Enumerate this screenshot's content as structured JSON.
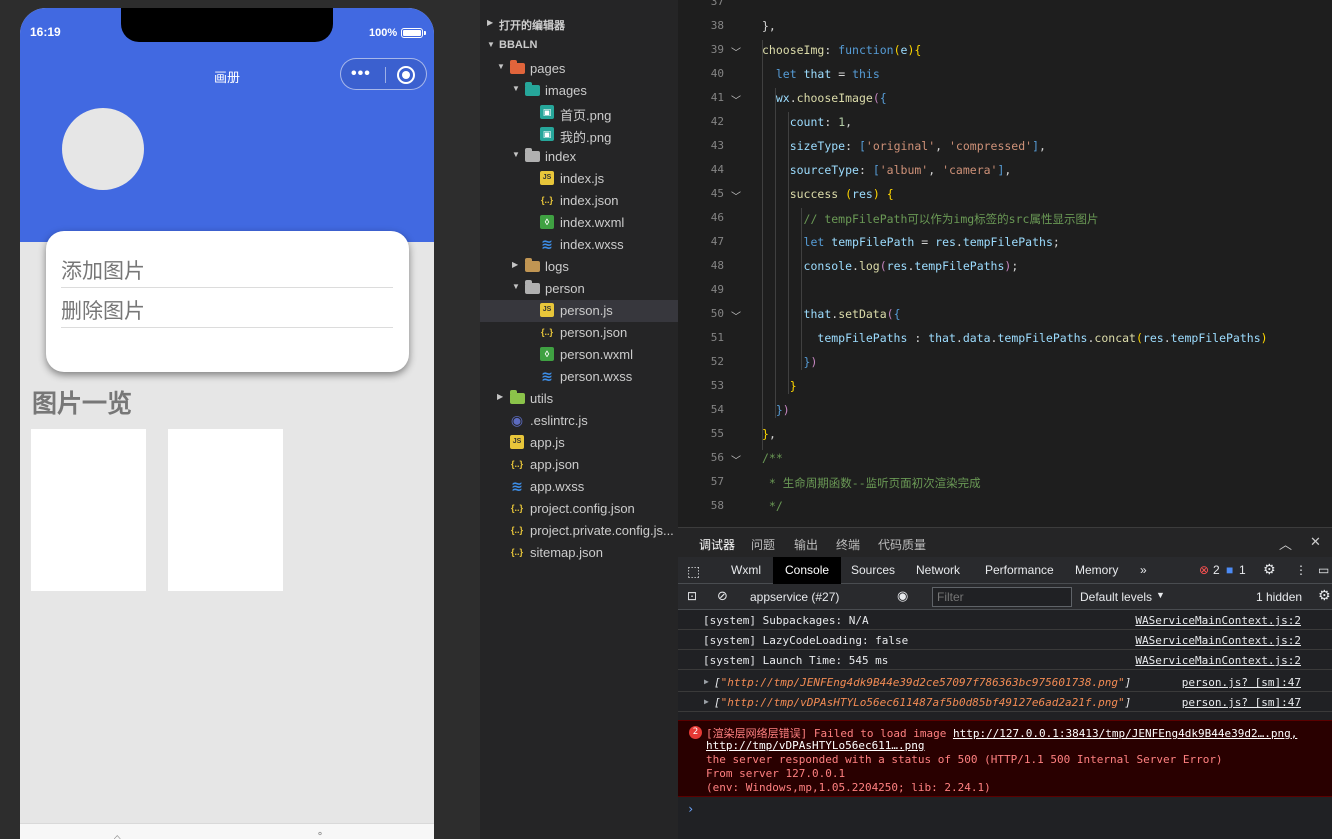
{
  "simulator": {
    "time": "16:19",
    "battery": "100%",
    "nav_title": "画册",
    "menu_items": [
      "添加图片",
      "删除图片"
    ],
    "section_title": "图片一览"
  },
  "explorer": {
    "open_editors": "打开的编辑器",
    "project": "BBALN",
    "items": [
      {
        "label": "pages",
        "type": "folder",
        "indent": 1,
        "open": true
      },
      {
        "label": "images",
        "type": "folder",
        "indent": 2,
        "open": true
      },
      {
        "label": "首页.png",
        "type": "png",
        "indent": 3
      },
      {
        "label": "我的.png",
        "type": "png",
        "indent": 3
      },
      {
        "label": "index",
        "type": "folder",
        "indent": 2,
        "open": true
      },
      {
        "label": "index.js",
        "type": "js",
        "indent": 3
      },
      {
        "label": "index.json",
        "type": "json",
        "indent": 3
      },
      {
        "label": "index.wxml",
        "type": "wxml",
        "indent": 3
      },
      {
        "label": "index.wxss",
        "type": "wxss",
        "indent": 3
      },
      {
        "label": "logs",
        "type": "folder",
        "indent": 2,
        "open": false
      },
      {
        "label": "person",
        "type": "folder",
        "indent": 2,
        "open": true
      },
      {
        "label": "person.js",
        "type": "js",
        "indent": 3,
        "selected": true
      },
      {
        "label": "person.json",
        "type": "json",
        "indent": 3
      },
      {
        "label": "person.wxml",
        "type": "wxml",
        "indent": 3
      },
      {
        "label": "person.wxss",
        "type": "wxss",
        "indent": 3
      },
      {
        "label": "utils",
        "type": "folder",
        "indent": 1,
        "open": false
      },
      {
        "label": ".eslintrc.js",
        "type": "eslint",
        "indent": 1
      },
      {
        "label": "app.js",
        "type": "js",
        "indent": 1
      },
      {
        "label": "app.json",
        "type": "json",
        "indent": 1
      },
      {
        "label": "app.wxss",
        "type": "wxss",
        "indent": 1
      },
      {
        "label": "project.config.json",
        "type": "json",
        "indent": 1
      },
      {
        "label": "project.private.config.js...",
        "type": "json",
        "indent": 1
      },
      {
        "label": "sitemap.json",
        "type": "json",
        "indent": 1
      }
    ]
  },
  "editor": {
    "lines": [
      {
        "n": "37",
        "html": ""
      },
      {
        "n": "38",
        "html": "<span class='punc'>},</span>"
      },
      {
        "n": "39",
        "fold": true,
        "html": "<span class='fn'>chooseImg</span><span class='punc'>: </span><span class='kw2'>function</span><span class='yel'>(</span><span class='prop'>e</span><span class='yel'>)</span><span class='yel'>{</span>"
      },
      {
        "n": "40",
        "html": "  <span class='kw2'>let</span> <span class='prop'>that</span> = <span class='kw2'>this</span>"
      },
      {
        "n": "41",
        "fold": true,
        "html": "  <span class='prop'>wx</span>.<span class='fn'>chooseImage</span><span class='kw'>(</span><span class='kw2'>{</span>"
      },
      {
        "n": "42",
        "html": "    <span class='prop'>count</span>: <span class='num'>1</span>,"
      },
      {
        "n": "43",
        "html": "    <span class='prop'>sizeType</span>: <span class='kw2'>[</span><span class='str'>'original'</span>, <span class='str'>'compressed'</span><span class='kw2'>]</span>,"
      },
      {
        "n": "44",
        "html": "    <span class='prop'>sourceType</span>: <span class='kw2'>[</span><span class='str'>'album'</span>, <span class='str'>'camera'</span><span class='kw2'>]</span>,"
      },
      {
        "n": "45",
        "fold": true,
        "html": "    <span class='fn'>success</span> <span class='yel'>(</span><span class='prop'>res</span><span class='yel'>)</span> <span class='yel'>{</span>"
      },
      {
        "n": "46",
        "html": "      <span class='com'>// tempFilePath可以作为img标签的src属性显示图片</span>"
      },
      {
        "n": "47",
        "html": "      <span class='kw2'>let</span> <span class='prop'>tempFilePath</span> = <span class='prop'>res</span>.<span class='prop'>tempFilePaths</span>;"
      },
      {
        "n": "48",
        "html": "      <span class='prop'>console</span>.<span class='fn'>log</span><span class='kw'>(</span><span class='prop'>res</span>.<span class='prop'>tempFilePaths</span><span class='kw'>)</span>;"
      },
      {
        "n": "49",
        "html": ""
      },
      {
        "n": "50",
        "fold": true,
        "html": "      <span class='prop'>that</span>.<span class='fn'>setData</span><span class='kw'>(</span><span class='kw2'>{</span>"
      },
      {
        "n": "51",
        "html": "        <span class='prop'>tempFilePaths</span> : <span class='prop'>that</span>.<span class='prop'>data</span>.<span class='prop'>tempFilePaths</span>.<span class='fn'>concat</span><span class='yel'>(</span><span class='prop'>res</span>.<span class='prop'>tempFilePaths</span><span class='yel'>)</span>"
      },
      {
        "n": "52",
        "html": "      <span class='kw2'>}</span><span class='kw'>)</span>"
      },
      {
        "n": "53",
        "html": "    <span class='yel'>}</span>"
      },
      {
        "n": "54",
        "html": "  <span class='kw2'>}</span><span class='kw'>)</span>"
      },
      {
        "n": "55",
        "html": "<span class='yel'>}</span>,"
      },
      {
        "n": "56",
        "fold": true,
        "html": "<span class='com'>/**</span>"
      },
      {
        "n": "57",
        "html": "<span class='com'> * 生命周期函数--监听页面初次渲染完成</span>"
      },
      {
        "n": "58",
        "html": "<span class='com'> */</span>"
      }
    ]
  },
  "devtools": {
    "tabs": [
      "调试器",
      "问题",
      "输出",
      "终端",
      "代码质量"
    ],
    "panel_tabs": [
      "Wxml",
      "Console",
      "Sources",
      "Network",
      "Performance",
      "Memory"
    ],
    "errors": "2",
    "messages": "1",
    "context": "appservice (#27)",
    "filter_placeholder": "Filter",
    "levels": "Default levels",
    "hidden": "1 hidden",
    "logs": [
      {
        "msg": "[system] Subpackages: N/A",
        "src": "WAServiceMainContext.js:2"
      },
      {
        "msg": "[system] LazyCodeLoading: false",
        "src": "WAServiceMainContext.js:2"
      },
      {
        "msg": "[system] Launch Time: 545 ms",
        "src": "WAServiceMainContext.js:2"
      },
      {
        "msg": "[\"http://tmp/JENFEng4dk9B44e39d2ce57097f786363bc975601738.png\"]",
        "src": "person.js? [sm]:47"
      },
      {
        "msg": "[\"http://tmp/vDPAsHTYLo56ec611487af5b0d85bf49127e6ad2a21f.png\"]",
        "src": "person.js? [sm]:47"
      }
    ],
    "error": {
      "count": "2",
      "prefix": "[渲染层网络层错误] Failed to load image ",
      "link1": "http://127.0.0.1:38413/tmp/JENFEng4dk9B44e39d2….png,",
      "link2": "http://tmp/vDPAsHTYLo56ec611….png",
      "line3": "the server responded with a status of 500 (HTTP/1.1 500 Internal Server Error)",
      "line4": "From server 127.0.0.1",
      "line5": "(env: Windows,mp,1.05.2204250; lib: 2.24.1)"
    }
  }
}
